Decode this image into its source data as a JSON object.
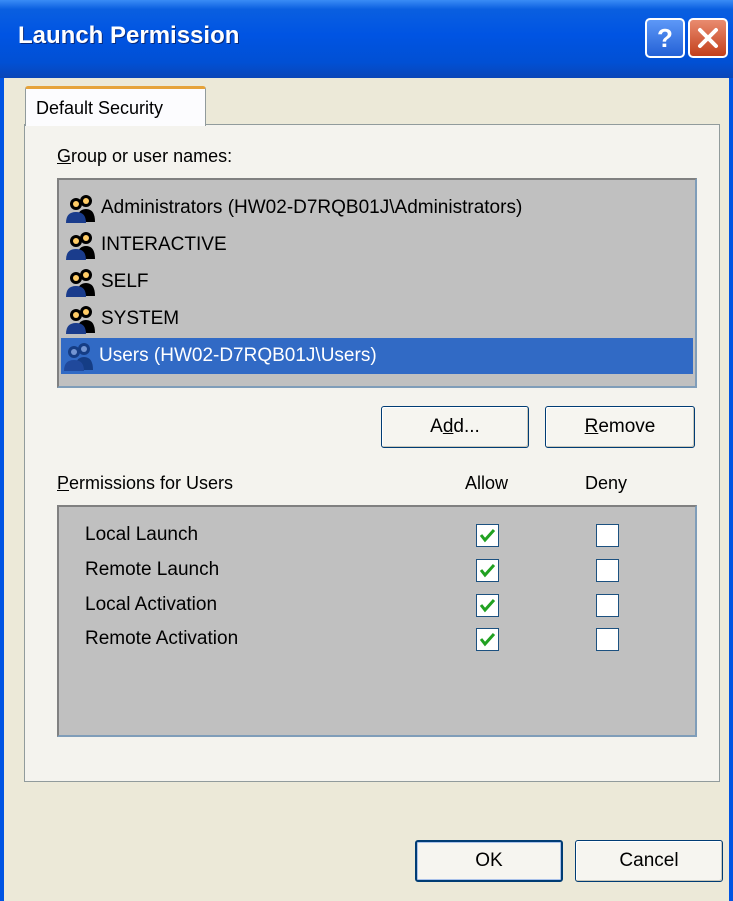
{
  "window": {
    "title": "Launch Permission",
    "title_gradient": "#0054e3"
  },
  "tabs": [
    {
      "label": "Default Security",
      "selected": true
    }
  ],
  "group_label": {
    "mnemonic": "G",
    "rest": "roup or user names:"
  },
  "users": [
    {
      "name": "Administrators (HW02-D7RQB01J\\Administrators)",
      "icon": "user-group-icon",
      "selected": false
    },
    {
      "name": "INTERACTIVE",
      "icon": "user-group-icon",
      "selected": false
    },
    {
      "name": "SELF",
      "icon": "user-group-icon",
      "selected": false
    },
    {
      "name": "SYSTEM",
      "icon": "user-group-icon",
      "selected": false
    },
    {
      "name": "Users (HW02-D7RQB01J\\Users)",
      "icon": "user-group-icon",
      "selected": true
    }
  ],
  "buttons": {
    "add": {
      "pre": "A",
      "mnemonic": "d",
      "post": "d..."
    },
    "remove": {
      "pre": "",
      "mnemonic": "R",
      "post": "emove"
    },
    "ok": "OK",
    "cancel": "Cancel"
  },
  "permissions": {
    "label": {
      "mnemonic": "P",
      "rest": "ermissions for Users"
    },
    "allow_header": "Allow",
    "deny_header": "Deny",
    "rows": [
      {
        "name": "Local Launch",
        "allow": true,
        "deny": false
      },
      {
        "name": "Remote Launch",
        "allow": true,
        "deny": false
      },
      {
        "name": "Local Activation",
        "allow": true,
        "deny": false
      },
      {
        "name": "Remote Activation",
        "allow": true,
        "deny": false
      }
    ]
  },
  "colors": {
    "selection": "#316ac5",
    "check": "#21a121",
    "dialog_bg": "#ece9d8"
  }
}
